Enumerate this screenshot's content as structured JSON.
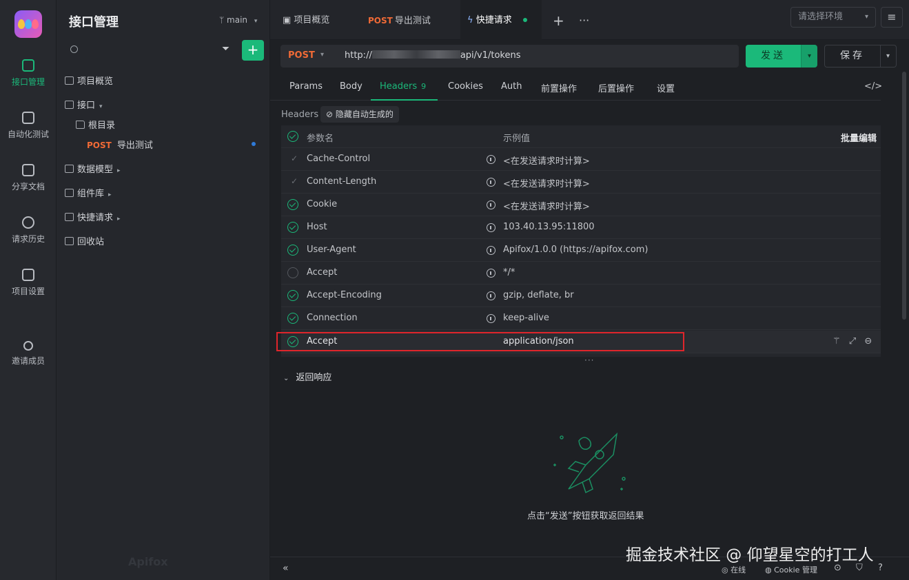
{
  "rail": {
    "items": [
      {
        "label": "接口管理",
        "icon": "api-icon",
        "active": true
      },
      {
        "label": "自动化测试",
        "icon": "automation-icon"
      },
      {
        "label": "分享文档",
        "icon": "share-doc-icon"
      },
      {
        "label": "请求历史",
        "icon": "history-icon"
      },
      {
        "label": "项目设置",
        "icon": "settings-icon"
      },
      {
        "label": "邀请成员",
        "icon": "invite-member-icon"
      }
    ]
  },
  "sidebar": {
    "title": "接口管理",
    "branch": "main",
    "tree": [
      {
        "label": "项目概览"
      },
      {
        "label": "接口"
      },
      {
        "label": "根目录"
      },
      {
        "method": "POST",
        "label": "导出测试"
      },
      {
        "label": "数据模型"
      },
      {
        "label": "组件库"
      },
      {
        "label": "快捷请求"
      },
      {
        "label": "回收站"
      }
    ],
    "logo_watermark": "Apifox"
  },
  "tabs": [
    {
      "label": "项目概览"
    },
    {
      "method": "POST",
      "label": "导出测试"
    },
    {
      "label": "快捷请求",
      "active": true
    }
  ],
  "env_select": {
    "placeholder": "请选择环境"
  },
  "request": {
    "method": "POST",
    "url_prefix": "http://",
    "url_suffix": "api/v1/tokens",
    "send_label": "发送",
    "save_label": "保存"
  },
  "subtabs": [
    {
      "label": "Params"
    },
    {
      "label": "Body"
    },
    {
      "label": "Headers",
      "badge": "9",
      "active": true
    },
    {
      "label": "Cookies"
    },
    {
      "label": "Auth"
    },
    {
      "label": "前置操作"
    },
    {
      "label": "后置操作"
    },
    {
      "label": "设置"
    }
  ],
  "headers_section": {
    "label": "Headers",
    "hide_auto": "隐藏自动生成的",
    "col_name": "参数名",
    "col_value": "示例值",
    "batch_edit": "批量编辑",
    "rows": [
      {
        "name": "Cache-Control",
        "value": "<在发送请求时计算>",
        "state": "tick"
      },
      {
        "name": "Content-Length",
        "value": "<在发送请求时计算>",
        "state": "tick"
      },
      {
        "name": "Cookie",
        "value": "<在发送请求时计算>",
        "state": "on"
      },
      {
        "name": "Host",
        "value": "103.40.13.95:11800",
        "state": "on"
      },
      {
        "name": "User-Agent",
        "value": "Apifox/1.0.0 (https://apifox.com)",
        "state": "on"
      },
      {
        "name": "Accept",
        "value": "*/*",
        "state": "off"
      },
      {
        "name": "Accept-Encoding",
        "value": "gzip, deflate, br",
        "state": "on"
      },
      {
        "name": "Connection",
        "value": "keep-alive",
        "state": "on"
      },
      {
        "name": "Accept",
        "value": "application/json",
        "state": "on"
      }
    ]
  },
  "response": {
    "title": "返回响应",
    "empty_text": "点击“发送”按钮获取返回结果"
  },
  "footer": {
    "online": "在线",
    "cookie_manage": "Cookie 管理"
  },
  "watermark": "掘金技术社区 @ 仰望星空的打工人",
  "colors": {
    "accent": "#1bb97a",
    "post": "#f06a36",
    "highlight": "#e0252b"
  }
}
